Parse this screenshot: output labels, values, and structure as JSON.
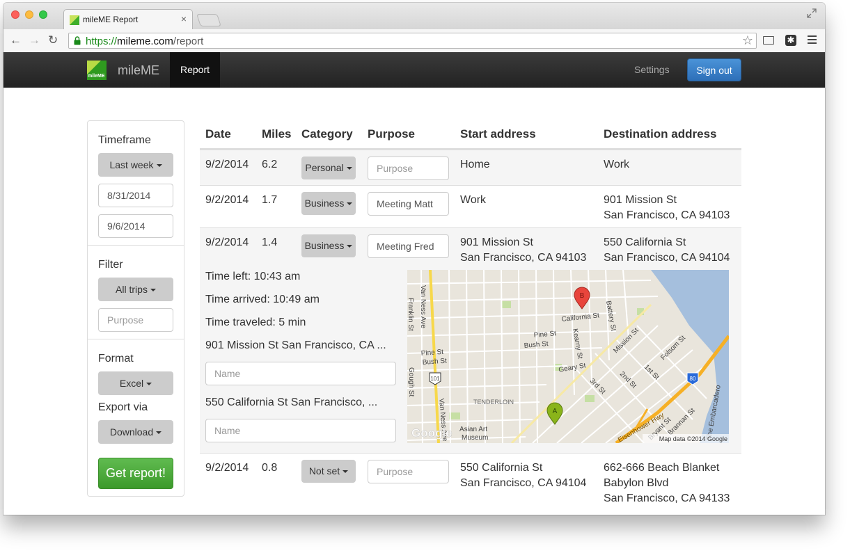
{
  "browser": {
    "tab_title": "mileME Report",
    "url_scheme": "https://",
    "url_host": "mileme.com",
    "url_path": "/report"
  },
  "navbar": {
    "brand_logo_text": "mileME",
    "brand": "mileME",
    "active_item": "Report",
    "settings": "Settings",
    "sign_out": "Sign out"
  },
  "sidebar": {
    "timeframe_label": "Timeframe",
    "timeframe_value": "Last week",
    "start_date": "8/31/2014",
    "end_date": "9/6/2014",
    "filter_label": "Filter",
    "filter_value": "All trips",
    "purpose_placeholder": "Purpose",
    "format_label": "Format",
    "format_value": "Excel",
    "export_label": "Export via",
    "export_value": "Download",
    "get_report": "Get report!"
  },
  "table": {
    "headers": [
      "Date",
      "Miles",
      "Category",
      "Purpose",
      "Start address",
      "Destination address"
    ],
    "rows": [
      {
        "date": "9/2/2014",
        "miles": "6.2",
        "category": "Personal",
        "purpose": "",
        "purpose_placeholder": "Purpose",
        "start": [
          "Home"
        ],
        "destination": [
          "Work"
        ]
      },
      {
        "date": "9/2/2014",
        "miles": "1.7",
        "category": "Business",
        "purpose": "Meeting Matt",
        "purpose_placeholder": "Purpose",
        "start": [
          "Work"
        ],
        "destination": [
          "901 Mission St",
          "San Francisco, CA 94103"
        ]
      },
      {
        "date": "9/2/2014",
        "miles": "1.4",
        "category": "Business",
        "purpose": "Meeting Fred",
        "purpose_placeholder": "Purpose",
        "start": [
          "901 Mission St",
          "San Francisco, CA 94103"
        ],
        "destination": [
          "550 California St",
          "San Francisco, CA 94104"
        ]
      },
      {
        "date": "9/2/2014",
        "miles": "0.8",
        "category": "Not set",
        "purpose": "",
        "purpose_placeholder": "Purpose",
        "start": [
          "550 California St",
          "San Francisco, CA 94104"
        ],
        "destination": [
          "662-666 Beach Blanket",
          "Babylon Blvd",
          "San Francisco, CA 94133"
        ]
      }
    ],
    "detail": {
      "time_left": "Time left: 10:43 am",
      "time_arrived": "Time arrived: 10:49 am",
      "time_traveled": "Time traveled: 5 min",
      "start_address": "901 Mission St San Francisco, CA ...",
      "start_name_placeholder": "Name",
      "end_address": "550 California St San Francisco, ...",
      "end_name_placeholder": "Name"
    }
  },
  "map": {
    "streets": [
      "Van Ness Ave",
      "Franklin St",
      "California St",
      "Pine St",
      "Bush St",
      "Kearny St",
      "Battery St",
      "Mission St",
      "Folsom St",
      "1st St",
      "2nd St",
      "3rd St",
      "Geary St",
      "Pine St",
      "Bush St",
      "Gough St",
      "Van Ness Ave",
      "Brannan St",
      "Bryant St",
      "The Embarcadero",
      "Eisenhower Hwy"
    ],
    "districts": [
      "TENDERLOIN",
      "Asian Art",
      "Museum"
    ],
    "route_badges": [
      "101",
      "80"
    ],
    "marker_a": "A",
    "marker_b": "B",
    "attribution": "Map data ©2014 Google",
    "google_mark": "Google",
    "colors": {
      "land": "#e9e5dc",
      "water": "#a5bfdd",
      "park": "#c6dfa4",
      "highway": "#f6b026",
      "marker_a": "#8ab41a",
      "marker_b": "#e8453c"
    }
  }
}
